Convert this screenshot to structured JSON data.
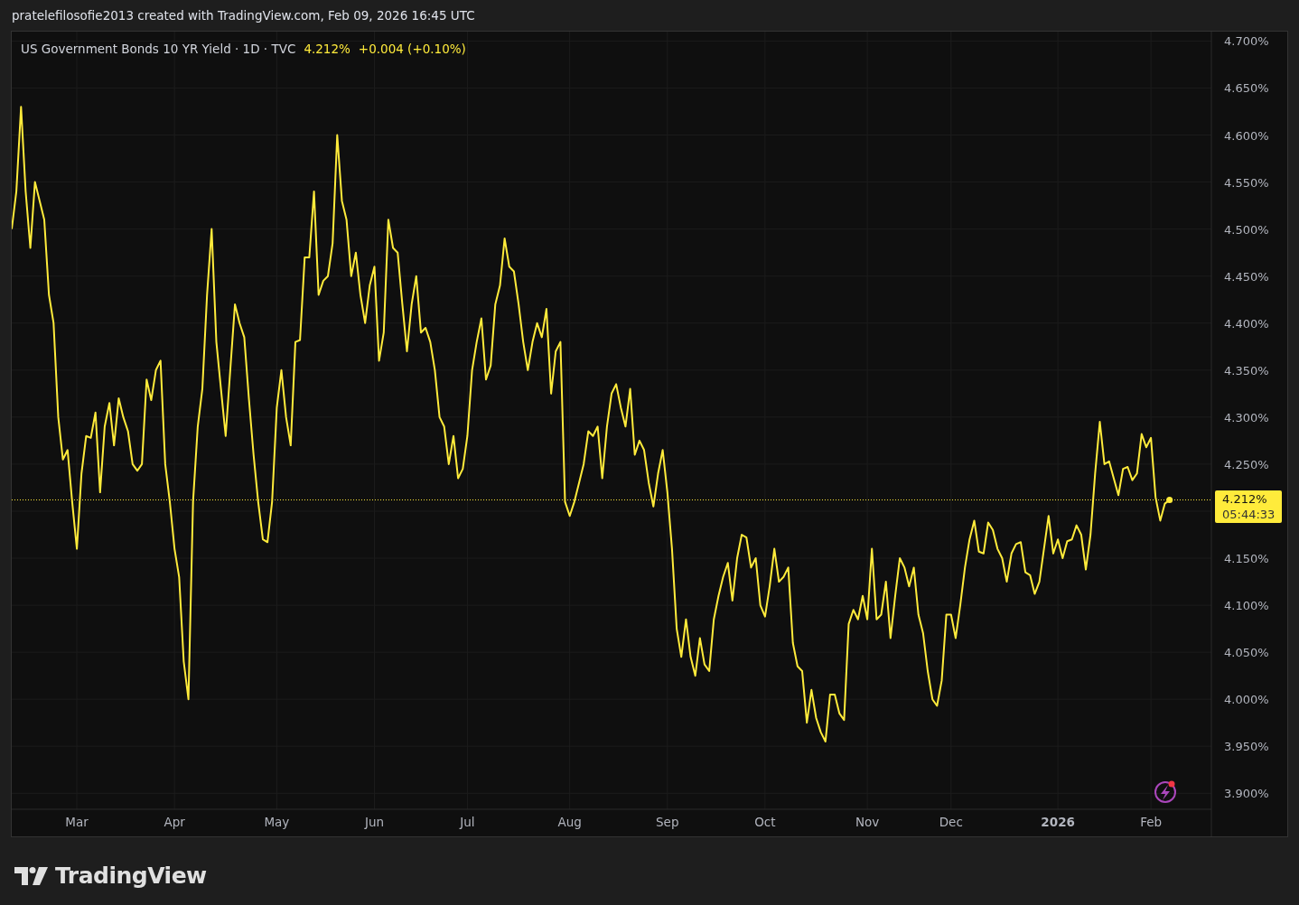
{
  "header": {
    "text": "pratelefilosofie2013 created with TradingView.com, Feb 09, 2026 16:45 UTC"
  },
  "legend": {
    "price": "4.212%",
    "change": "+0.004 (+0.10%)"
  },
  "last_price": {
    "countdown": "05:44:33"
  },
  "chart": {
    "chart_data": {
      "type": "line",
      "grid": true,
      "ylim": [
        3.883,
        4.71
      ],
      "ref_lines": [
        {
          "axis": "y",
          "value": 4.212,
          "color": "#ffeb3b",
          "label": "4.212%"
        }
      ],
      "yticks": [
        {
          "value": 4.7,
          "label": "4.700%"
        },
        {
          "value": 4.65,
          "label": "4.650%"
        },
        {
          "value": 4.6,
          "label": "4.600%"
        },
        {
          "value": 4.55,
          "label": "4.550%"
        },
        {
          "value": 4.5,
          "label": "4.500%"
        },
        {
          "value": 4.45,
          "label": "4.450%"
        },
        {
          "value": 4.4,
          "label": "4.400%"
        },
        {
          "value": 4.35,
          "label": "4.350%"
        },
        {
          "value": 4.3,
          "label": "4.300%"
        },
        {
          "value": 4.25,
          "label": "4.250%"
        },
        {
          "value": 4.15,
          "label": "4.150%"
        },
        {
          "value": 4.1,
          "label": "4.100%"
        },
        {
          "value": 4.05,
          "label": "4.050%"
        },
        {
          "value": 4.0,
          "label": "4.000%"
        },
        {
          "value": 3.95,
          "label": "3.950%"
        },
        {
          "value": 3.9,
          "label": "3.900%"
        }
      ],
      "categories": [
        null,
        null,
        null,
        null,
        null,
        null,
        null,
        null,
        null,
        null,
        null,
        null,
        null,
        null,
        "Mar",
        null,
        null,
        null,
        null,
        null,
        null,
        null,
        null,
        null,
        null,
        null,
        null,
        null,
        null,
        null,
        null,
        null,
        null,
        null,
        null,
        "Apr",
        null,
        null,
        null,
        null,
        null,
        null,
        null,
        null,
        null,
        null,
        null,
        null,
        null,
        null,
        null,
        null,
        null,
        null,
        null,
        null,
        null,
        "May",
        null,
        null,
        null,
        null,
        null,
        null,
        null,
        null,
        null,
        null,
        null,
        null,
        null,
        null,
        null,
        null,
        null,
        null,
        null,
        null,
        "Jun",
        null,
        null,
        null,
        null,
        null,
        null,
        null,
        null,
        null,
        null,
        null,
        null,
        null,
        null,
        null,
        null,
        null,
        null,
        null,
        "Jul",
        null,
        null,
        null,
        null,
        null,
        null,
        null,
        null,
        null,
        null,
        null,
        null,
        null,
        null,
        null,
        null,
        null,
        null,
        null,
        null,
        null,
        "Aug",
        null,
        null,
        null,
        null,
        null,
        null,
        null,
        null,
        null,
        null,
        null,
        null,
        null,
        null,
        null,
        null,
        null,
        null,
        null,
        null,
        "Sep",
        null,
        null,
        null,
        null,
        null,
        null,
        null,
        null,
        null,
        null,
        null,
        null,
        null,
        null,
        null,
        null,
        null,
        null,
        null,
        null,
        "Oct",
        null,
        null,
        null,
        null,
        null,
        null,
        null,
        null,
        null,
        null,
        null,
        null,
        null,
        null,
        null,
        null,
        null,
        null,
        null,
        null,
        null,
        "Nov",
        null,
        null,
        null,
        null,
        null,
        null,
        null,
        null,
        null,
        null,
        null,
        null,
        null,
        null,
        null,
        null,
        null,
        "Dec",
        null,
        null,
        null,
        null,
        null,
        null,
        null,
        null,
        null,
        null,
        null,
        null,
        null,
        null,
        null,
        null,
        null,
        null,
        null,
        null,
        null,
        null,
        "2026",
        null,
        null,
        null,
        null,
        null,
        null,
        null,
        null,
        null,
        null,
        null,
        null,
        null,
        null,
        null,
        null,
        null,
        null,
        null,
        "Feb",
        null,
        null,
        null,
        null
      ],
      "series": [
        {
          "name": "US Government Bonds 10 YR Yield · 1D · TVC",
          "color": "#ffeb3b",
          "values": [
            4.5,
            4.54,
            4.63,
            4.54,
            4.48,
            4.55,
            4.53,
            4.51,
            4.43,
            4.4,
            4.3,
            4.255,
            4.265,
            4.21,
            4.16,
            4.24,
            4.28,
            4.278,
            4.305,
            4.22,
            4.29,
            4.315,
            4.27,
            4.32,
            4.3,
            4.285,
            4.25,
            4.243,
            4.25,
            4.34,
            4.318,
            4.35,
            4.36,
            4.25,
            4.21,
            4.16,
            4.13,
            4.04,
            4.0,
            4.21,
            4.29,
            4.33,
            4.43,
            4.5,
            4.38,
            4.33,
            4.28,
            4.35,
            4.42,
            4.4,
            4.385,
            4.32,
            4.26,
            4.21,
            4.17,
            4.167,
            4.21,
            4.31,
            4.35,
            4.3,
            4.27,
            4.38,
            4.382,
            4.47,
            4.47,
            4.54,
            4.43,
            4.445,
            4.45,
            4.485,
            4.6,
            4.53,
            4.51,
            4.45,
            4.475,
            4.43,
            4.4,
            4.44,
            4.46,
            4.36,
            4.39,
            4.51,
            4.48,
            4.475,
            4.42,
            4.37,
            4.42,
            4.45,
            4.39,
            4.395,
            4.38,
            4.35,
            4.3,
            4.29,
            4.25,
            4.28,
            4.235,
            4.245,
            4.28,
            4.35,
            4.38,
            4.405,
            4.34,
            4.355,
            4.42,
            4.44,
            4.49,
            4.46,
            4.455,
            4.42,
            4.38,
            4.35,
            4.38,
            4.4,
            4.385,
            4.415,
            4.325,
            4.37,
            4.38,
            4.21,
            4.195,
            4.21,
            4.23,
            4.25,
            4.285,
            4.28,
            4.29,
            4.235,
            4.29,
            4.325,
            4.335,
            4.31,
            4.29,
            4.33,
            4.26,
            4.275,
            4.265,
            4.23,
            4.205,
            4.24,
            4.265,
            4.22,
            4.16,
            4.075,
            4.045,
            4.085,
            4.045,
            4.025,
            4.065,
            4.037,
            4.03,
            4.085,
            4.11,
            4.13,
            4.145,
            4.105,
            4.15,
            4.175,
            4.172,
            4.14,
            4.15,
            4.1,
            4.088,
            4.12,
            4.16,
            4.125,
            4.13,
            4.14,
            4.06,
            4.035,
            4.03,
            3.975,
            4.01,
            3.98,
            3.965,
            3.955,
            4.005,
            4.005,
            3.985,
            3.978,
            4.08,
            4.095,
            4.085,
            4.11,
            4.085,
            4.16,
            4.085,
            4.09,
            4.125,
            4.065,
            4.11,
            4.15,
            4.14,
            4.12,
            4.14,
            4.09,
            4.07,
            4.03,
            4.0,
            3.993,
            4.02,
            4.09,
            4.09,
            4.065,
            4.1,
            4.14,
            4.17,
            4.19,
            4.157,
            4.155,
            4.188,
            4.18,
            4.16,
            4.15,
            4.125,
            4.155,
            4.165,
            4.167,
            4.135,
            4.132,
            4.112,
            4.125,
            4.16,
            4.195,
            4.155,
            4.17,
            4.15,
            4.168,
            4.17,
            4.185,
            4.175,
            4.138,
            4.175,
            4.24,
            4.295,
            4.25,
            4.253,
            4.235,
            4.217,
            4.245,
            4.247,
            4.233,
            4.24,
            4.282,
            4.268,
            4.278,
            4.215,
            4.19,
            4.208,
            4.212
          ]
        }
      ]
    }
  },
  "footer": {
    "logo_text": "TradingView"
  }
}
